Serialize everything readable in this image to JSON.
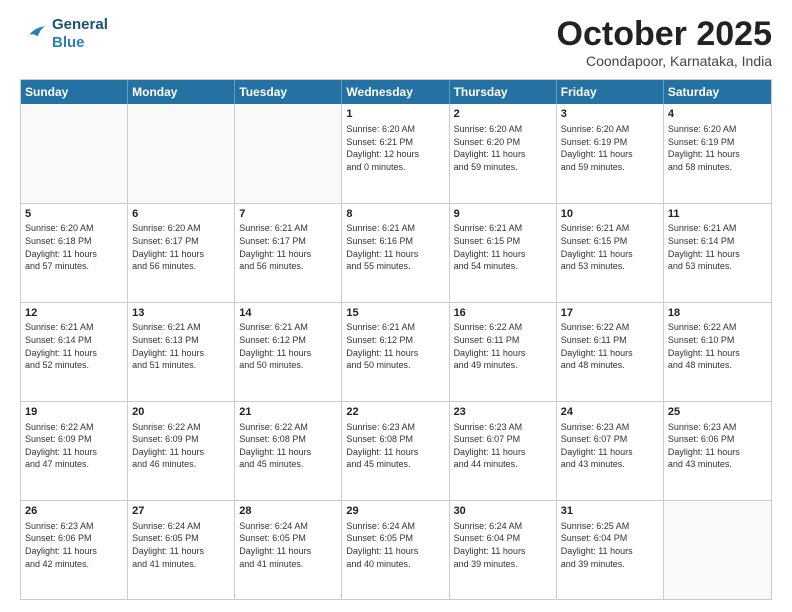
{
  "header": {
    "logo_line1": "General",
    "logo_line2": "Blue",
    "month": "October 2025",
    "location": "Coondapoor, Karnataka, India"
  },
  "weekdays": [
    "Sunday",
    "Monday",
    "Tuesday",
    "Wednesday",
    "Thursday",
    "Friday",
    "Saturday"
  ],
  "rows": [
    [
      {
        "day": "",
        "lines": []
      },
      {
        "day": "",
        "lines": []
      },
      {
        "day": "",
        "lines": []
      },
      {
        "day": "1",
        "lines": [
          "Sunrise: 6:20 AM",
          "Sunset: 6:21 PM",
          "Daylight: 12 hours",
          "and 0 minutes."
        ]
      },
      {
        "day": "2",
        "lines": [
          "Sunrise: 6:20 AM",
          "Sunset: 6:20 PM",
          "Daylight: 11 hours",
          "and 59 minutes."
        ]
      },
      {
        "day": "3",
        "lines": [
          "Sunrise: 6:20 AM",
          "Sunset: 6:19 PM",
          "Daylight: 11 hours",
          "and 59 minutes."
        ]
      },
      {
        "day": "4",
        "lines": [
          "Sunrise: 6:20 AM",
          "Sunset: 6:19 PM",
          "Daylight: 11 hours",
          "and 58 minutes."
        ]
      }
    ],
    [
      {
        "day": "5",
        "lines": [
          "Sunrise: 6:20 AM",
          "Sunset: 6:18 PM",
          "Daylight: 11 hours",
          "and 57 minutes."
        ]
      },
      {
        "day": "6",
        "lines": [
          "Sunrise: 6:20 AM",
          "Sunset: 6:17 PM",
          "Daylight: 11 hours",
          "and 56 minutes."
        ]
      },
      {
        "day": "7",
        "lines": [
          "Sunrise: 6:21 AM",
          "Sunset: 6:17 PM",
          "Daylight: 11 hours",
          "and 56 minutes."
        ]
      },
      {
        "day": "8",
        "lines": [
          "Sunrise: 6:21 AM",
          "Sunset: 6:16 PM",
          "Daylight: 11 hours",
          "and 55 minutes."
        ]
      },
      {
        "day": "9",
        "lines": [
          "Sunrise: 6:21 AM",
          "Sunset: 6:15 PM",
          "Daylight: 11 hours",
          "and 54 minutes."
        ]
      },
      {
        "day": "10",
        "lines": [
          "Sunrise: 6:21 AM",
          "Sunset: 6:15 PM",
          "Daylight: 11 hours",
          "and 53 minutes."
        ]
      },
      {
        "day": "11",
        "lines": [
          "Sunrise: 6:21 AM",
          "Sunset: 6:14 PM",
          "Daylight: 11 hours",
          "and 53 minutes."
        ]
      }
    ],
    [
      {
        "day": "12",
        "lines": [
          "Sunrise: 6:21 AM",
          "Sunset: 6:14 PM",
          "Daylight: 11 hours",
          "and 52 minutes."
        ]
      },
      {
        "day": "13",
        "lines": [
          "Sunrise: 6:21 AM",
          "Sunset: 6:13 PM",
          "Daylight: 11 hours",
          "and 51 minutes."
        ]
      },
      {
        "day": "14",
        "lines": [
          "Sunrise: 6:21 AM",
          "Sunset: 6:12 PM",
          "Daylight: 11 hours",
          "and 50 minutes."
        ]
      },
      {
        "day": "15",
        "lines": [
          "Sunrise: 6:21 AM",
          "Sunset: 6:12 PM",
          "Daylight: 11 hours",
          "and 50 minutes."
        ]
      },
      {
        "day": "16",
        "lines": [
          "Sunrise: 6:22 AM",
          "Sunset: 6:11 PM",
          "Daylight: 11 hours",
          "and 49 minutes."
        ]
      },
      {
        "day": "17",
        "lines": [
          "Sunrise: 6:22 AM",
          "Sunset: 6:11 PM",
          "Daylight: 11 hours",
          "and 48 minutes."
        ]
      },
      {
        "day": "18",
        "lines": [
          "Sunrise: 6:22 AM",
          "Sunset: 6:10 PM",
          "Daylight: 11 hours",
          "and 48 minutes."
        ]
      }
    ],
    [
      {
        "day": "19",
        "lines": [
          "Sunrise: 6:22 AM",
          "Sunset: 6:09 PM",
          "Daylight: 11 hours",
          "and 47 minutes."
        ]
      },
      {
        "day": "20",
        "lines": [
          "Sunrise: 6:22 AM",
          "Sunset: 6:09 PM",
          "Daylight: 11 hours",
          "and 46 minutes."
        ]
      },
      {
        "day": "21",
        "lines": [
          "Sunrise: 6:22 AM",
          "Sunset: 6:08 PM",
          "Daylight: 11 hours",
          "and 45 minutes."
        ]
      },
      {
        "day": "22",
        "lines": [
          "Sunrise: 6:23 AM",
          "Sunset: 6:08 PM",
          "Daylight: 11 hours",
          "and 45 minutes."
        ]
      },
      {
        "day": "23",
        "lines": [
          "Sunrise: 6:23 AM",
          "Sunset: 6:07 PM",
          "Daylight: 11 hours",
          "and 44 minutes."
        ]
      },
      {
        "day": "24",
        "lines": [
          "Sunrise: 6:23 AM",
          "Sunset: 6:07 PM",
          "Daylight: 11 hours",
          "and 43 minutes."
        ]
      },
      {
        "day": "25",
        "lines": [
          "Sunrise: 6:23 AM",
          "Sunset: 6:06 PM",
          "Daylight: 11 hours",
          "and 43 minutes."
        ]
      }
    ],
    [
      {
        "day": "26",
        "lines": [
          "Sunrise: 6:23 AM",
          "Sunset: 6:06 PM",
          "Daylight: 11 hours",
          "and 42 minutes."
        ]
      },
      {
        "day": "27",
        "lines": [
          "Sunrise: 6:24 AM",
          "Sunset: 6:05 PM",
          "Daylight: 11 hours",
          "and 41 minutes."
        ]
      },
      {
        "day": "28",
        "lines": [
          "Sunrise: 6:24 AM",
          "Sunset: 6:05 PM",
          "Daylight: 11 hours",
          "and 41 minutes."
        ]
      },
      {
        "day": "29",
        "lines": [
          "Sunrise: 6:24 AM",
          "Sunset: 6:05 PM",
          "Daylight: 11 hours",
          "and 40 minutes."
        ]
      },
      {
        "day": "30",
        "lines": [
          "Sunrise: 6:24 AM",
          "Sunset: 6:04 PM",
          "Daylight: 11 hours",
          "and 39 minutes."
        ]
      },
      {
        "day": "31",
        "lines": [
          "Sunrise: 6:25 AM",
          "Sunset: 6:04 PM",
          "Daylight: 11 hours",
          "and 39 minutes."
        ]
      },
      {
        "day": "",
        "lines": []
      }
    ]
  ]
}
